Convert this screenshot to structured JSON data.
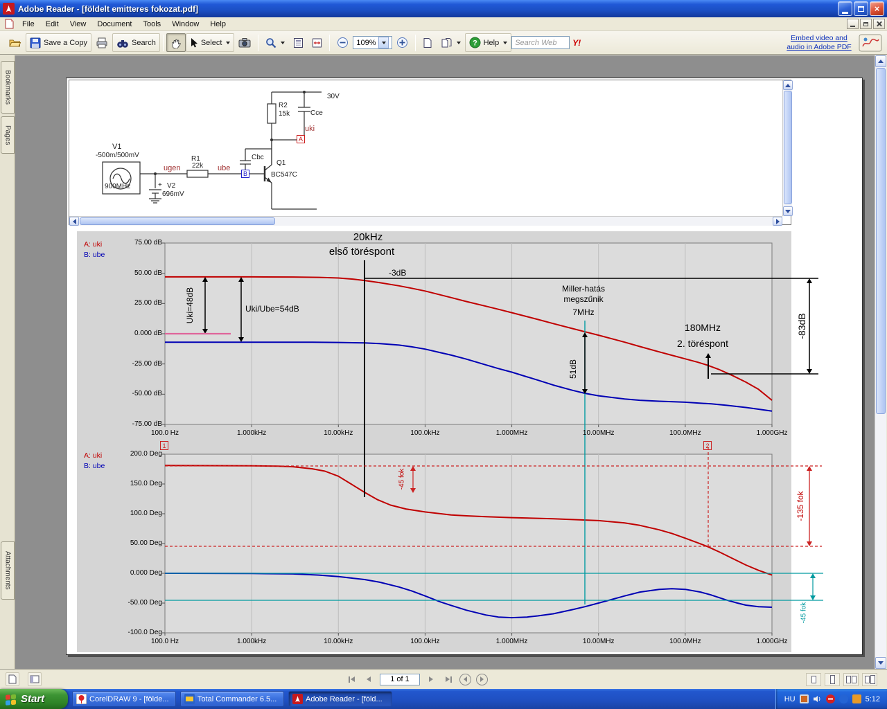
{
  "colors": {
    "titlebar_blue": "#1b4fc4",
    "taskbar_blue": "#1f4fc0",
    "start_green": "#3d9434",
    "curve_a_red": "#c00000",
    "curve_b_blue": "#0000b4",
    "annotation_red": "#cc2222",
    "cursor_cyan": "#009aa0",
    "ref_magenta": "#e0649a"
  },
  "icons": {
    "close_glyph": "×",
    "help_glyph": "?"
  },
  "window": {
    "title": "Adobe Reader - [földelt emitteres fokozat.pdf]",
    "menu_items": [
      "File",
      "Edit",
      "View",
      "Document",
      "Tools",
      "Window",
      "Help"
    ]
  },
  "toolbar": {
    "save_copy_label": "Save a Copy",
    "search_label": "Search",
    "select_label": "Select",
    "zoom_value": "109%",
    "help_label": "Help",
    "search_web_placeholder": "Search Web",
    "yahoo_label": "Y!",
    "embed_link_label": "Embed video and audio in Adobe PDF"
  },
  "sidebar": {
    "bookmarks_tab": "Bookmarks",
    "pages_tab": "Pages",
    "attachments_tab": "Attachments"
  },
  "statusbar": {
    "page_indicator": "1 of 1"
  },
  "taskbar": {
    "start_label": "Start",
    "tasks": [
      {
        "label": "CorelDRAW 9 - [földe..."
      },
      {
        "label": "Total Commander 6.5..."
      },
      {
        "label": "Adobe Reader - [föld..."
      }
    ],
    "language_indicator": "HU",
    "clock": "5:12"
  },
  "circuit": {
    "v1_name": "V1",
    "v1_value": "-500m/500mV",
    "v1_freq": "900MHz",
    "v2_plus": "+",
    "v2_name": "V2",
    "v2_value": "696mV",
    "r1_name": "R1",
    "r1_value": "22k",
    "r2_name": "R2",
    "r2_value": "15k",
    "q1_name": "Q1",
    "q1_model": "BC547C",
    "cbc": "Cbc",
    "cce": "Cce",
    "supply": "30V",
    "ugen": "ugen",
    "ube": "ube",
    "uki": "uki",
    "node_a": "A",
    "node_b": "B"
  },
  "chart_data": [
    {
      "type": "line",
      "title": "Gain magnitude vs frequency (Bode plot, PSpice Probe)",
      "x_scale": "log",
      "x_ticks": [
        "100.0 Hz",
        "1.000kHz",
        "10.00kHz",
        "100.0kHz",
        "1.000MHz",
        "10.00MHz",
        "100.0MHz",
        "1.000GHz"
      ],
      "x_tick_values": [
        100,
        1000,
        10000,
        100000,
        1000000,
        10000000,
        100000000,
        1000000000
      ],
      "y_ticks": [
        "75.00 dB",
        "50.00 dB",
        "25.00 dB",
        "0.000 dB",
        "-25.00 dB",
        "-50.00 dB",
        "-75.00 dB"
      ],
      "y_tick_values": [
        75,
        50,
        25,
        0,
        -25,
        -50,
        -75
      ],
      "ylim": [
        -75,
        75
      ],
      "grid": "vertical-decades",
      "legend_position": "top-left",
      "series": [
        {
          "name": "A: uki",
          "color": "#c00000",
          "points": [
            [
              100,
              47
            ],
            [
              300,
              47
            ],
            [
              1000,
              47
            ],
            [
              3000,
              46.9
            ],
            [
              6000,
              46.6
            ],
            [
              10000,
              46.1
            ],
            [
              15000,
              45.1
            ],
            [
              20000,
              44
            ],
            [
              30000,
              42.2
            ],
            [
              50000,
              39.6
            ],
            [
              70000,
              37.6
            ],
            [
              100000,
              35.3
            ],
            [
              200000,
              29.9
            ],
            [
              300000,
              26.6
            ],
            [
              500000,
              22.8
            ],
            [
              700000,
              20.2
            ],
            [
              1000000,
              17.4
            ],
            [
              2000000,
              11.8
            ],
            [
              3000000,
              8.4
            ],
            [
              5000000,
              4.3
            ],
            [
              7000000,
              1.6
            ],
            [
              10000000,
              -1.2
            ],
            [
              20000000,
              -7
            ],
            [
              30000000,
              -10.6
            ],
            [
              50000000,
              -15
            ],
            [
              70000000,
              -17.8
            ],
            [
              100000000,
              -20.8
            ],
            [
              140000000,
              -23.6
            ],
            [
              180000000,
              -26
            ],
            [
              250000000,
              -29.8
            ],
            [
              350000000,
              -34.5
            ],
            [
              500000000,
              -40
            ],
            [
              700000000,
              -46
            ],
            [
              1000000000,
              -55
            ]
          ]
        },
        {
          "name": "B: ube",
          "color": "#0000b4",
          "points": [
            [
              100,
              -7
            ],
            [
              1000,
              -7
            ],
            [
              5000,
              -7
            ],
            [
              10000,
              -7.2
            ],
            [
              20000,
              -7.6
            ],
            [
              30000,
              -8.2
            ],
            [
              50000,
              -9.4
            ],
            [
              70000,
              -10.8
            ],
            [
              100000,
              -12.7
            ],
            [
              200000,
              -17.7
            ],
            [
              300000,
              -21
            ],
            [
              500000,
              -25.7
            ],
            [
              700000,
              -28.8
            ],
            [
              1000000,
              -31.8
            ],
            [
              2000000,
              -38.4
            ],
            [
              3000000,
              -42.4
            ],
            [
              5000000,
              -46.8
            ],
            [
              7000000,
              -49.3
            ],
            [
              10000000,
              -51.3
            ],
            [
              20000000,
              -54
            ],
            [
              30000000,
              -55
            ],
            [
              50000000,
              -55.8
            ],
            [
              100000000,
              -56.6
            ],
            [
              200000000,
              -58
            ],
            [
              300000000,
              -59.2
            ],
            [
              500000000,
              -61
            ],
            [
              700000000,
              -62.4
            ],
            [
              1000000000,
              -64
            ]
          ]
        }
      ],
      "annotations": {
        "freq_break1": "20kHz",
        "break1": "első töréspont",
        "minus3db": "-3dB",
        "uki_gain": "Uki=48dB",
        "ratio_gain": "Uki/Ube=54dB",
        "miller_line1": "Miller-hatás",
        "miller_line2": "megszűnik",
        "miller_freq": "7MHz",
        "drop_51db": "51dB",
        "freq_break2": "180MHz",
        "break2": "2. töréspont",
        "total_drop": "-83dB",
        "cursor1": "1",
        "cursor2": "2"
      }
    },
    {
      "type": "line",
      "title": "Phase vs frequency (Bode plot, PSpice Probe)",
      "x_scale": "log",
      "x_ticks": [
        "100.0 Hz",
        "1.000kHz",
        "10.00kHz",
        "100.0kHz",
        "1.000MHz",
        "10.00MHz",
        "100.0MHz",
        "1.000GHz"
      ],
      "x_tick_values": [
        100,
        1000,
        10000,
        100000,
        1000000,
        10000000,
        100000000,
        1000000000
      ],
      "y_ticks": [
        "200.0 Deg",
        "150.0 Deg",
        "100.0 Deg",
        "50.00 Deg",
        "0.000 Deg",
        "-50.00 Deg",
        "-100.0 Deg"
      ],
      "y_tick_values": [
        200,
        150,
        100,
        50,
        0,
        -50,
        -100
      ],
      "ylim": [
        -100,
        200
      ],
      "grid": "vertical-decades",
      "legend_position": "top-left",
      "series": [
        {
          "name": "A: uki",
          "color": "#c00000",
          "points": [
            [
              100,
              181
            ],
            [
              1000,
              180.5
            ],
            [
              2000,
              180
            ],
            [
              3000,
              179
            ],
            [
              5000,
              175.5
            ],
            [
              7000,
              171.5
            ],
            [
              10000,
              163
            ],
            [
              14000,
              150
            ],
            [
              20000,
              136
            ],
            [
              28000,
              124
            ],
            [
              40000,
              114.5
            ],
            [
              60000,
              108
            ],
            [
              100000,
              103
            ],
            [
              200000,
              98
            ],
            [
              300000,
              96.5
            ],
            [
              500000,
              95
            ],
            [
              1000000,
              93.5
            ],
            [
              3000000,
              91.5
            ],
            [
              10000000,
              88.5
            ],
            [
              20000000,
              84.5
            ],
            [
              30000000,
              80.5
            ],
            [
              50000000,
              73
            ],
            [
              70000000,
              67
            ],
            [
              100000000,
              59
            ],
            [
              140000000,
              51
            ],
            [
              180000000,
              45
            ],
            [
              250000000,
              35.5
            ],
            [
              350000000,
              25
            ],
            [
              500000000,
              14
            ],
            [
              700000000,
              5
            ],
            [
              1000000000,
              -3
            ]
          ]
        },
        {
          "name": "B: ube",
          "color": "#0000b4",
          "points": [
            [
              100,
              0
            ],
            [
              1000,
              -0.3
            ],
            [
              3000,
              -1
            ],
            [
              6000,
              -3
            ],
            [
              10000,
              -5.5
            ],
            [
              20000,
              -10.5
            ],
            [
              30000,
              -15
            ],
            [
              50000,
              -23
            ],
            [
              70000,
              -29.5
            ],
            [
              100000,
              -38
            ],
            [
              150000,
              -48
            ],
            [
              200000,
              -54
            ],
            [
              300000,
              -62
            ],
            [
              500000,
              -70
            ],
            [
              700000,
              -73.5
            ],
            [
              1000000,
              -74.5
            ],
            [
              1500000,
              -73.5
            ],
            [
              2000000,
              -71.5
            ],
            [
              3000000,
              -68
            ],
            [
              5000000,
              -61
            ],
            [
              7000000,
              -56
            ],
            [
              10000000,
              -50
            ],
            [
              15000000,
              -43
            ],
            [
              20000000,
              -38
            ],
            [
              30000000,
              -31.5
            ],
            [
              50000000,
              -27
            ],
            [
              70000000,
              -25.8
            ],
            [
              100000000,
              -27
            ],
            [
              150000000,
              -31.5
            ],
            [
              200000000,
              -36.5
            ],
            [
              300000000,
              -45
            ],
            [
              400000000,
              -50
            ],
            [
              500000000,
              -53.5
            ],
            [
              700000000,
              -56
            ],
            [
              1000000000,
              -57
            ]
          ]
        }
      ],
      "annotations": {
        "fok45_first": "-45 fok",
        "fok135_total": "-135 fok",
        "fok45_ube": "-45 fok"
      }
    }
  ]
}
